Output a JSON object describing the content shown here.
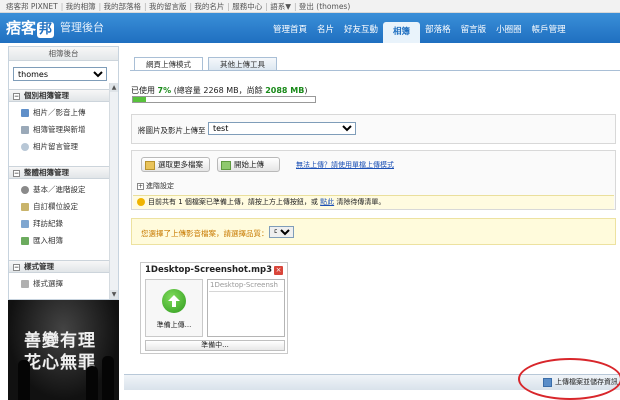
{
  "toplinks": [
    "痞客邦 PIXNET",
    "我的相簿",
    "我的部落格",
    "我的留言版",
    "我的名片",
    "服務中心",
    "語系▼",
    "登出 (thomes)"
  ],
  "header": {
    "logo_text": "痞客",
    "logo_box": "邦",
    "subtitle": "管理後台",
    "nav": [
      {
        "label": "管理首頁",
        "active": false
      },
      {
        "label": "名片",
        "active": false
      },
      {
        "label": "好友互動",
        "active": false
      },
      {
        "label": "相簿",
        "active": true
      },
      {
        "label": "部落格",
        "active": false
      },
      {
        "label": "留言版",
        "active": false
      },
      {
        "label": "小圈圈",
        "active": false
      },
      {
        "label": "帳戶管理",
        "active": false
      }
    ]
  },
  "sidebar": {
    "title": "相簿後台",
    "account": "thomes",
    "sections": [
      {
        "label": "個別相簿管理",
        "items": [
          "相片／影音上傳",
          "相簿管理與新增",
          "相片留言管理"
        ]
      },
      {
        "label": "整體相簿管理",
        "items": [
          "基本／進階設定",
          "自訂欄位設定",
          "拜訪紀錄",
          "匯入相簿"
        ]
      },
      {
        "label": "樣式管理",
        "items": [
          "樣式選擇"
        ]
      }
    ]
  },
  "banner": {
    "line1": "善變有理",
    "line2": "花心無罪"
  },
  "tabs": [
    {
      "label": "網頁上傳模式",
      "active": true
    },
    {
      "label": "其他上傳工具",
      "active": false
    }
  ],
  "usage": {
    "prefix": "已使用",
    "percent_text": "7%",
    "total_label": "(總容量",
    "total_value": "2268 MB",
    "remain_label": "，尚餘",
    "remain_value": "2088 MB",
    "suffix": ")",
    "fraction": 0.07
  },
  "upload_target": {
    "label": "將圖片及影片上傳至",
    "value": "test"
  },
  "buttons": {
    "select_more": "選取更多檔案",
    "upload_images": "開始上傳"
  },
  "help_link": "無法上傳？請使用單檔上傳模式",
  "advanced": "進階設定",
  "notice": {
    "text_before": "目前共有 1 個檔案已準備上傳，請按上方上傳按鈕，或",
    "link": "點此",
    "text_after": "清除待傳清單。"
  },
  "quality": {
    "text": "您選擇了上傳影音檔案，請選擇品質：",
    "value": "中"
  },
  "file": {
    "name": "1Desktop-Screenshot.mp3",
    "ready_label": "準備上傳...",
    "desc_placeholder": "1Desktop-Screensh",
    "status": "準備中..."
  },
  "bottom": {
    "save_label": "上傳檔案並儲存資訊"
  },
  "colors": {
    "brand": "#1f6fc0",
    "usage_green": "#1a8a1a",
    "highlight_circle": "#d8262b"
  }
}
